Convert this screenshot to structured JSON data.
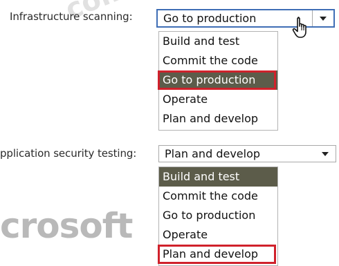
{
  "fields": [
    {
      "label": "Infrastructure scanning:",
      "value": "Go to production",
      "options": [
        "Build and test",
        "Commit the code",
        "Go to production",
        "Operate",
        "Plan and develop"
      ],
      "selected_index": 2,
      "highlighted_index": 2
    },
    {
      "label": "pplication security testing:",
      "value": "Plan and develop",
      "options": [
        "Build and test",
        "Commit the code",
        "Go to production",
        "Operate",
        "Plan and develop"
      ],
      "selected_index": 0,
      "highlighted_index": 4
    }
  ],
  "watermark": {
    "top": "com",
    "bottom": "crosoft"
  },
  "colors": {
    "selected_bg": "#5c5c4a",
    "highlight_border": "#d0212b",
    "focus_border": "#3e6db5"
  },
  "icons": {
    "cursor": "hand-pointer-icon",
    "dropdown": "chevron-down-icon"
  }
}
